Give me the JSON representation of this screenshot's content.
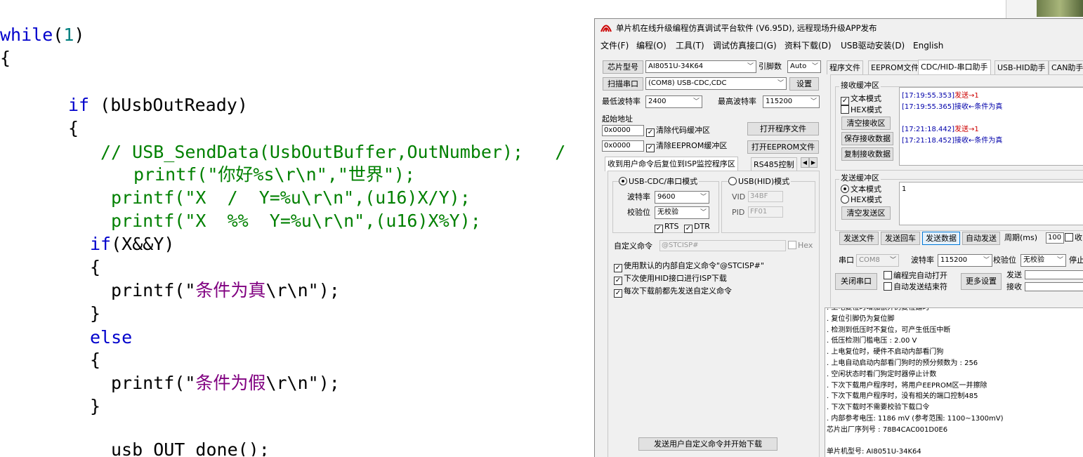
{
  "editor": {
    "lines": [
      [
        {
          "t": "while",
          "c": "kw"
        },
        {
          "t": "(",
          "c": ""
        },
        {
          "t": "1",
          "c": "num"
        },
        {
          "t": ")",
          "c": ""
        }
      ],
      [
        {
          "t": "{",
          "c": ""
        }
      ],
      [
        {
          "t": "if",
          "c": "kw"
        },
        {
          "t": " (bUsbOutReady)",
          "c": ""
        }
      ],
      [
        {
          "t": "{",
          "c": ""
        }
      ],
      [
        {
          "t": "// USB_SendData(UsbOutBuffer,OutNumber);   /",
          "c": "cm"
        }
      ],
      [
        {
          "t": "printf(\"你好%s\\r\\n\",\"世界\");",
          "c": "cm"
        }
      ],
      [
        {
          "t": "printf(\"X  /  Y=%u\\r\\n\",(u16)X/Y);",
          "c": "cm"
        }
      ],
      [
        {
          "t": "printf(\"X  %%  Y=%u\\r\\n\",(u16)X%Y);",
          "c": "cm"
        }
      ],
      [
        {
          "t": "if",
          "c": "kw"
        },
        {
          "t": "(X&&Y)",
          "c": ""
        }
      ],
      [
        {
          "t": "{",
          "c": ""
        }
      ],
      [
        {
          "t": "printf(\"",
          "c": ""
        },
        {
          "t": "条件为真",
          "c": "st"
        },
        {
          "t": "\\r\\n\");",
          "c": ""
        }
      ],
      [
        {
          "t": "}",
          "c": ""
        }
      ],
      [
        {
          "t": "else",
          "c": "kw"
        }
      ],
      [
        {
          "t": "{",
          "c": ""
        }
      ],
      [
        {
          "t": "printf(\"",
          "c": ""
        },
        {
          "t": "条件为假",
          "c": "st"
        },
        {
          "t": "\\r\\n\");",
          "c": ""
        }
      ],
      [
        {
          "t": "}",
          "c": ""
        }
      ],
      [
        {
          "t": "usb_OUT_done();",
          "c": ""
        }
      ]
    ]
  },
  "app": {
    "title": "单片机在线升级编程仿真调试平台软件 (V6.95D), 远程现场升级APP发布",
    "menu": [
      "文件(F)",
      "编程(O)",
      "工具(T)",
      "调试仿真接口(G)",
      "资料下载(D)",
      "USB驱动安装(D)",
      "English"
    ],
    "chip_label": "芯片型号",
    "chip_value": "AI8051U-34K64",
    "pins_label": "引脚数",
    "pins_value": "Auto",
    "scan_button": "扫描串口",
    "port_value": "(COM8) USB-CDC,CDC",
    "settings_button": "设置",
    "min_baud_label": "最低波特率",
    "min_baud_value": "2400",
    "max_baud_label": "最高波特率",
    "max_baud_value": "115200",
    "start_addr_label": "起始地址",
    "addr1": "0x0000",
    "clear_code_label": "清除代码缓冲区",
    "open_prog_button": "打开程序文件",
    "addr2": "0x0000",
    "clear_eeprom_label": "清除EEPROM缓冲区",
    "open_eeprom_button": "打开EEPROM文件",
    "left_tabs": [
      "收到用户命令后复位到ISP监控程序区",
      "RS485控制"
    ],
    "cdc_mode_label": "USB-CDC/串口模式",
    "hid_mode_label": "USB(HID)模式",
    "baud_label": "波特率",
    "baud_value": "9600",
    "parity_label": "校验位",
    "parity_value": "无校验",
    "rts_label": "RTS",
    "dtr_label": "DTR",
    "vid_label": "VID",
    "vid_value": "34BF",
    "pid_label": "PID",
    "pid_value": "FF01",
    "custom_cmd_label": "自定义命令",
    "custom_cmd_value": "@STCISP#",
    "hex_label": "Hex",
    "opt1": "使用默认的内部自定义命令\"@STCISP#\"",
    "opt2": "下次使用HID接口进行ISP下载",
    "opt3": "每次下载前都先发送自定义命令",
    "send_download_button": "发送用户自定义命令并开始下载",
    "right_tabs": [
      "程序文件",
      "EEPROM文件",
      "CDC/HID-串口助手",
      "USB-HID助手",
      "CAN助手"
    ],
    "recv_group": "接收缓冲区",
    "text_mode": "文本模式",
    "hex_mode": "HEX模式",
    "clear_recv_button": "清空接收区",
    "save_recv_button": "保存接收数据",
    "copy_recv_button": "复制接收数据",
    "recv_log": [
      {
        "time": "[17:19:55.353]",
        "text": "发送→1",
        "kind": "sent"
      },
      {
        "time": "[17:19:55.365]",
        "text": "接收←条件为真",
        "kind": "recv"
      },
      {
        "time": "",
        "text": "",
        "kind": "blank"
      },
      {
        "time": "[17:21:18.442]",
        "text": "发送→1",
        "kind": "sent"
      },
      {
        "time": "[17:21:18.452]",
        "text": "接收←条件为真",
        "kind": "recv"
      }
    ],
    "send_group": "发送缓冲区",
    "send_value": "1",
    "clear_send_button": "清空发送区",
    "send_file_button": "发送文件",
    "send_enter_button": "发送回车",
    "send_data_button": "发送数据",
    "auto_send_button": "自动发送",
    "period_label": "周期(ms)",
    "period_value": "100",
    "recv_trunc": "收",
    "port_label": "串口",
    "port_combo": "COM8",
    "baud2_label": "波特率",
    "baud2_value": "115200",
    "parity2_label": "校验位",
    "parity2_value": "无校验",
    "stop_trunc": "停止",
    "close_port_button": "关闭串口",
    "auto_open_label": "编程完自动打开",
    "auto_send_end_label": "自动发送结束符",
    "more_settings_button": "更多设置",
    "send_count_label": "发送",
    "recv_count_label": "接收",
    "info_lines": [
      "  . 上电复位时增加额外的复位延时",
      "  . 复位引脚仍为复位脚",
      "  . 检测到低压时不复位，可产生低压中断",
      "  . 低压检测门槛电压 : 2.00 V",
      "  . 上电复位时，硬件不启动内部看门狗",
      "  . 上电自动启动内部看门狗时的预分频数为 : 256",
      "  . 空闲状态时看门狗定时器停止计数",
      "  . 下次下载用户程序时，将用户EEPROM区一并擦除",
      "  . 下次下载用户程序时，没有相关的端口控制485",
      "  . 下次下载时不需要校验下载口令",
      "  . 内部参考电压: 1186 mV (参考范围: 1100~1300mV)",
      "芯片出厂序列号 : 78B4CAC001D0E6",
      "",
      "  单片机型号: AI8051U-34K64"
    ]
  }
}
